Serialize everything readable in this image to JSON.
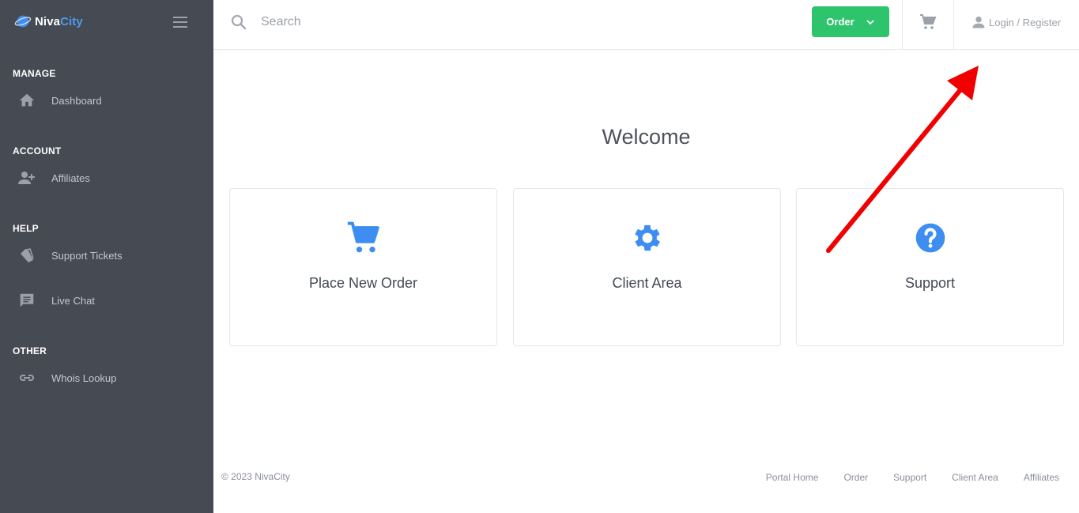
{
  "brand": {
    "name_part1": "Niva",
    "name_part2": "City"
  },
  "sidebar": {
    "sections": [
      {
        "title": "MANAGE",
        "items": [
          {
            "label": "Dashboard",
            "icon": "home-icon"
          }
        ]
      },
      {
        "title": "ACCOUNT",
        "items": [
          {
            "label": "Affiliates",
            "icon": "add-user-icon"
          }
        ]
      },
      {
        "title": "HELP",
        "items": [
          {
            "label": "Support Tickets",
            "icon": "ticket-icon"
          },
          {
            "label": "Live Chat",
            "icon": "chat-icon"
          }
        ]
      },
      {
        "title": "OTHER",
        "items": [
          {
            "label": "Whois Lookup",
            "icon": "link-icon"
          }
        ]
      }
    ]
  },
  "topbar": {
    "search_placeholder": "Search",
    "order_label": "Order",
    "login_label": "Login / Register"
  },
  "main": {
    "welcome": "Welcome",
    "cards": [
      {
        "label": "Place New Order",
        "icon": "cart-icon"
      },
      {
        "label": "Client Area",
        "icon": "gear-icon"
      },
      {
        "label": "Support",
        "icon": "question-icon"
      }
    ]
  },
  "footer": {
    "copyright": "© 2023 NivaCity",
    "links": [
      "Portal Home",
      "Order",
      "Support",
      "Client Area",
      "Affiliates"
    ]
  },
  "colors": {
    "sidebar_bg": "#464a53",
    "accent_blue": "#3d8ef0",
    "order_green": "#2ec46e",
    "annotation_red": "#f00000"
  }
}
